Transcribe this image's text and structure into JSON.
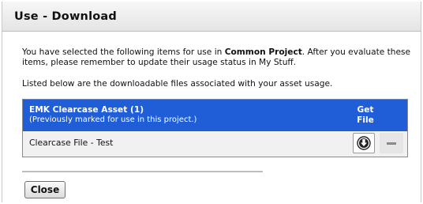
{
  "dialog": {
    "title": "Use - Download"
  },
  "intro": {
    "part1": "You have selected the following items for use in ",
    "project": "Common Project",
    "part2": ". After you evaluate these items, please remember to update their usage status in My Stuff."
  },
  "listed_text": "Listed below are the downloadable files associated with your asset usage.",
  "asset_table": {
    "asset_name": "EMK Clearcase Asset (1)",
    "asset_note": "(Previously marked for use in this project.)",
    "get_label": "Get",
    "file_label": "File",
    "header_color": "#1f5ed6",
    "rows": [
      {
        "file_name": "Clearcase File - Test"
      }
    ],
    "download_icon": "download-arrow-icon",
    "remove_icon": "minus-icon"
  },
  "buttons": {
    "close_label": "Close"
  }
}
